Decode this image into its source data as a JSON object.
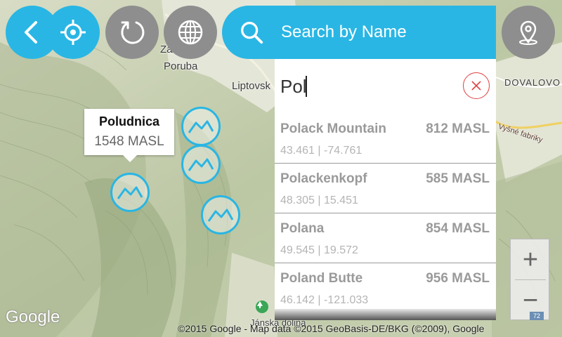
{
  "toolbar": {
    "back_icon": "chevron-left-icon",
    "locate_icon": "crosshair-icon",
    "refresh_icon": "refresh-icon",
    "globe_icon": "globe-icon",
    "search_icon": "search-icon",
    "pin_icon": "location-pin-icon"
  },
  "search": {
    "title": "Search by Name",
    "query": "Pol",
    "clear_icon": "close-icon",
    "results": [
      {
        "name": "Polack Mountain",
        "altitude": "812 MASL",
        "coords": "43.461 | -74.761"
      },
      {
        "name": "Polackenkopf",
        "altitude": "585 MASL",
        "coords": "48.305 | 15.451"
      },
      {
        "name": "Polana",
        "altitude": "854 MASL",
        "coords": "49.545 | 19.572"
      },
      {
        "name": "Poland Butte",
        "altitude": "956 MASL",
        "coords": "46.142 | -121.033"
      }
    ]
  },
  "callout": {
    "name": "Poludnica",
    "altitude": "1548 MASL"
  },
  "map": {
    "labels": {
      "town1_line1": "Závažná",
      "town1_line2": "Poruba",
      "town2": "Liptovsk",
      "town3": "DOVALOVO",
      "street": "Vyšné fabriky",
      "valley": "Jánska dolina"
    },
    "google_logo": "Google",
    "attribution": "©2015 Google - Map data ©2015 GeoBasis-DE/BKG (©2009), Google",
    "road_badge": "72"
  },
  "zoom": {
    "in_label": "+",
    "out_label": "−"
  },
  "colors": {
    "accent": "#29b6e4",
    "gray_button": "#8e8e8e",
    "clear_red": "#e04040"
  }
}
